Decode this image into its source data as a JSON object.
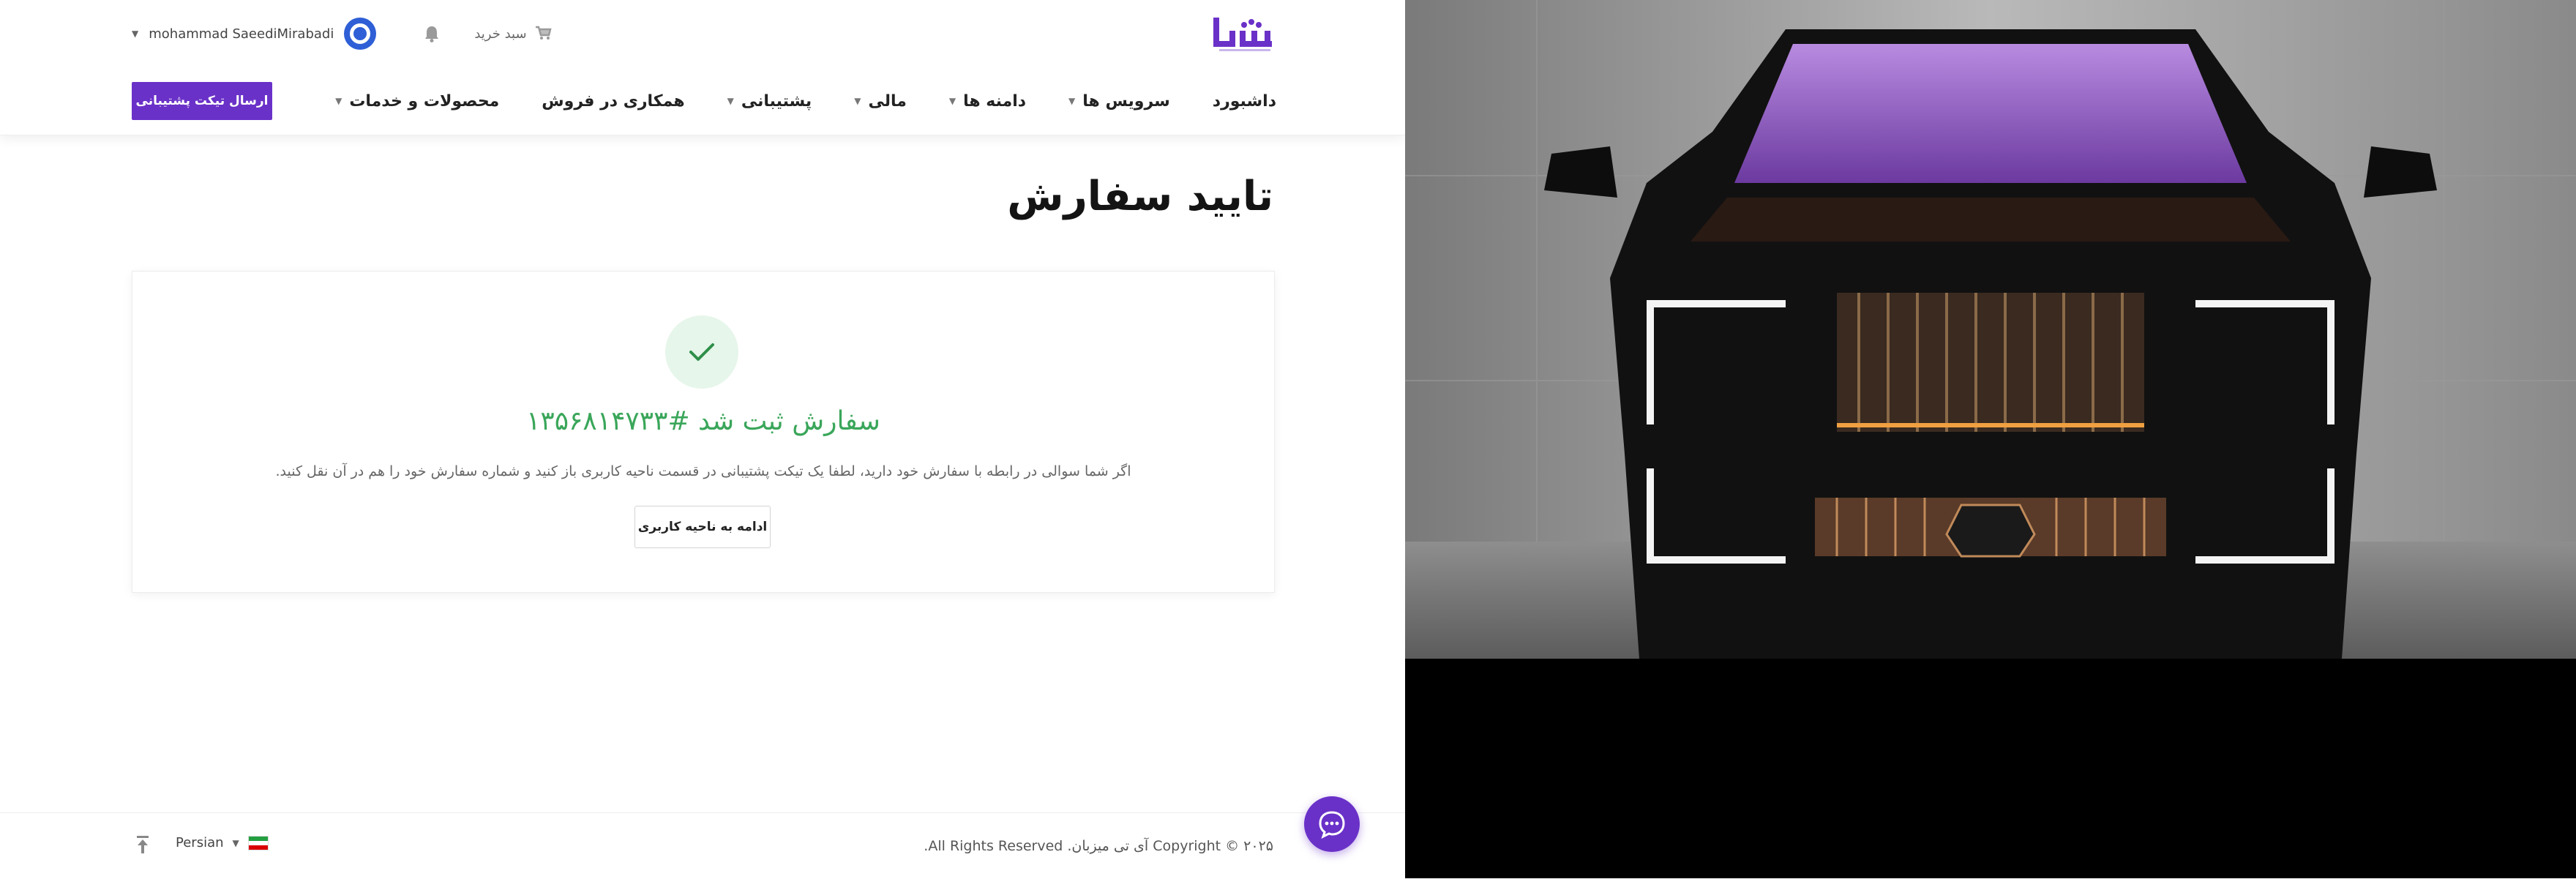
{
  "header": {
    "user_name": "mohammad SaeediMirabadi",
    "cart_label": "سبد خرید"
  },
  "nav": {
    "items": [
      {
        "label": "داشبورد",
        "has_caret": false
      },
      {
        "label": "سرویس ها",
        "has_caret": true
      },
      {
        "label": "دامنه ها",
        "has_caret": true
      },
      {
        "label": "مالی",
        "has_caret": true
      },
      {
        "label": "پشتیبانی",
        "has_caret": true
      },
      {
        "label": "همکاری در فروش",
        "has_caret": false
      },
      {
        "label": "محصولات و خدمات",
        "has_caret": true
      }
    ],
    "ticket_button": "ارسال تیکت پشتیبانی"
  },
  "page": {
    "title": "تایید سفارش"
  },
  "confirmation": {
    "title": "سفارش ثبت شد #۱۳۵۶۸۱۴۷۳۳",
    "description": "اگر شما سوالی در رابطه با سفارش خود دارید، لطفا یک تیکت پشتیبانی در قسمت ناحیه کاربری باز کنید و شماره سفارش خود را هم در آن نقل کنید.",
    "continue_button": "ادامه به ناحیه کاربری"
  },
  "footer": {
    "copyright": "Copyright © ۲۰۲۵ آی تی میزبان. All Rights Reserved.",
    "language": "Persian"
  },
  "colors": {
    "brand": "#6a31c8",
    "success": "#3aa65a",
    "avatar": "#2f5fd6"
  },
  "icons": [
    "logo-icon",
    "avatar-icon",
    "bell-icon",
    "cart-icon",
    "check-icon",
    "scroll-top-icon",
    "chat-icon",
    "iran-flag-icon"
  ]
}
